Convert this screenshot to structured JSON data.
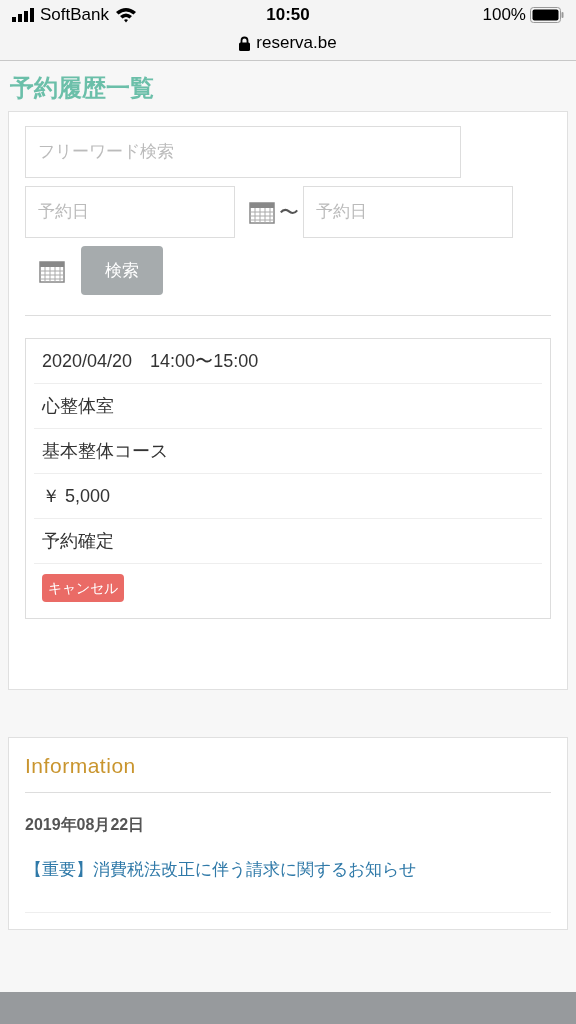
{
  "status_bar": {
    "carrier": "SoftBank",
    "time": "10:50",
    "battery": "100%",
    "url": "reserva.be"
  },
  "page_title": "予約履歴一覧",
  "search": {
    "keyword_placeholder": "フリーワード検索",
    "date_from_placeholder": "予約日",
    "separator": "〜",
    "date_to_placeholder": "予約日",
    "button": "検索"
  },
  "reservations": [
    {
      "datetime": "2020/04/20　14:00〜15:00",
      "shop": "心整体室",
      "course": "基本整体コース",
      "price": "￥ 5,000",
      "status": "予約確定",
      "cancel_button": "キャンセル"
    }
  ],
  "information": {
    "title": "Information",
    "items": [
      {
        "date": "2019年08月22日",
        "link": "【重要】消費税法改正に伴う請求に関するお知らせ"
      }
    ]
  }
}
